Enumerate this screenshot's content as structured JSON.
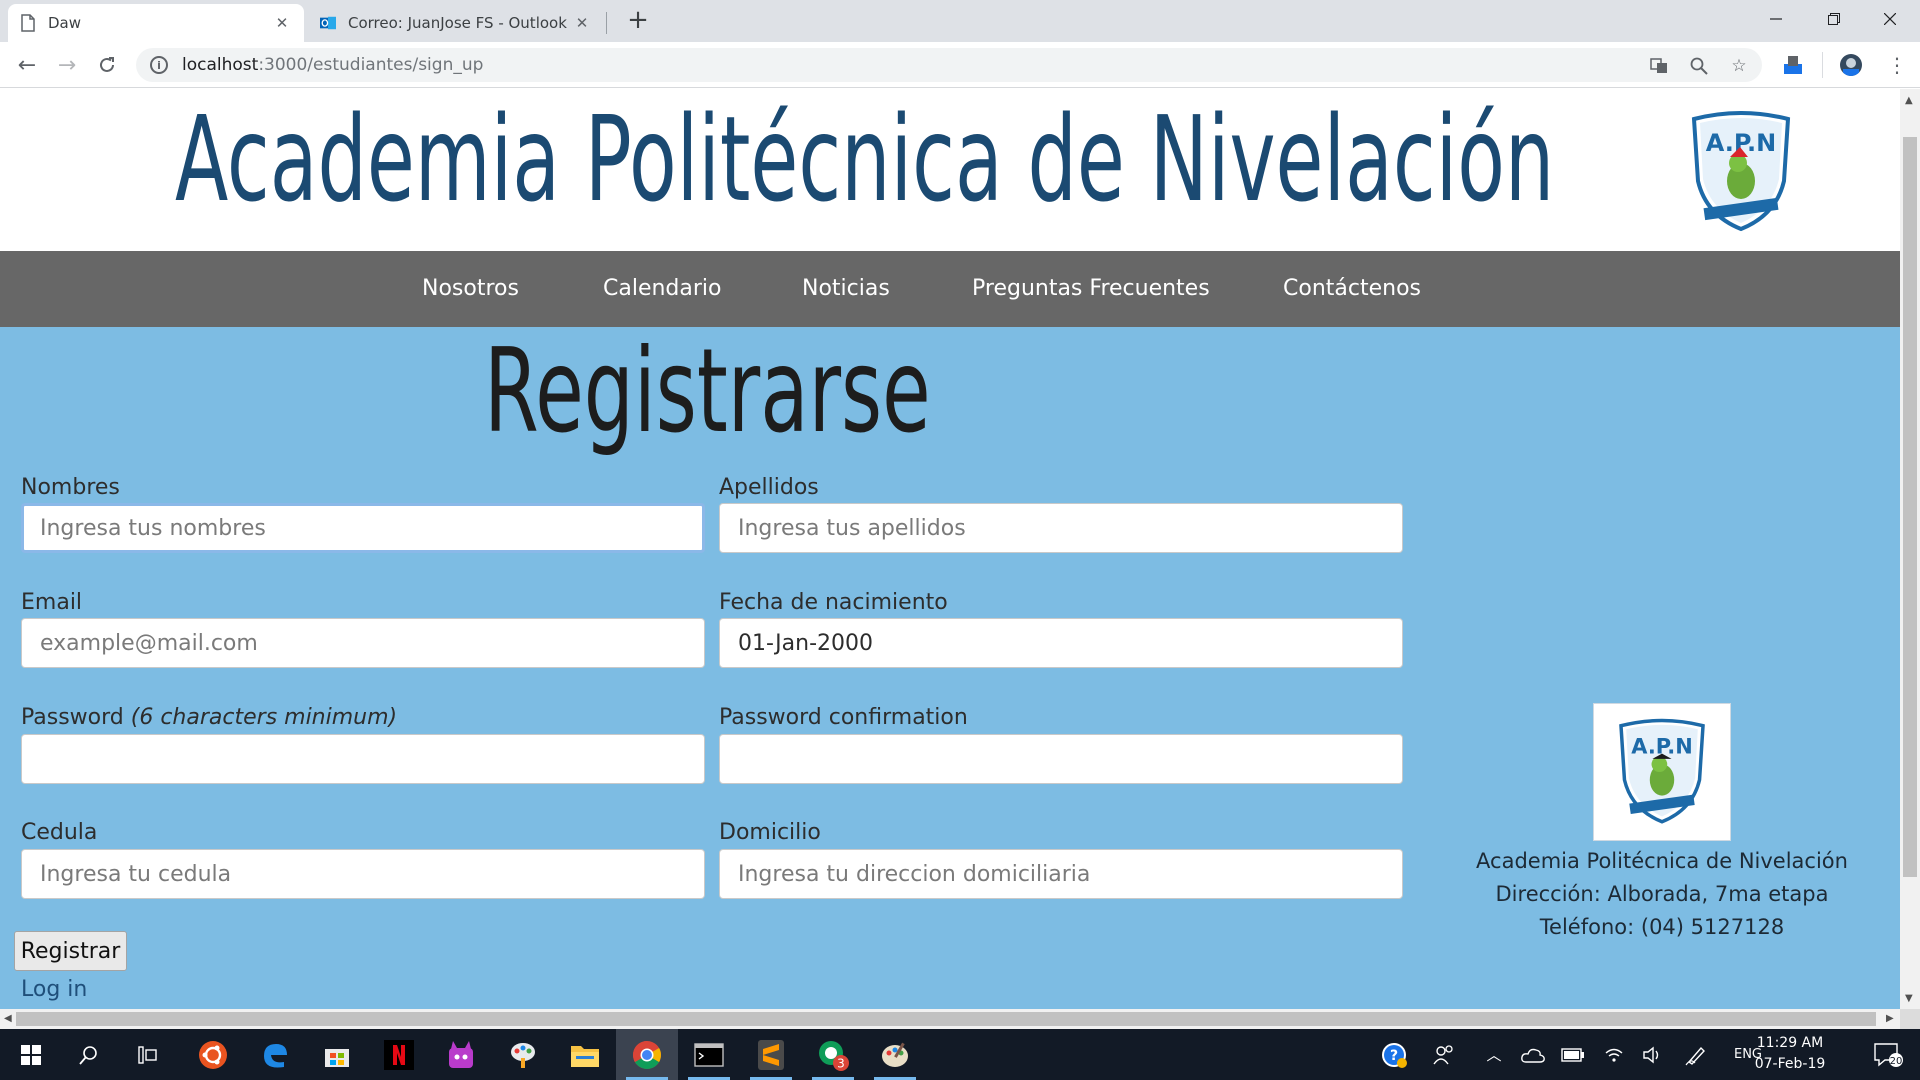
{
  "browser": {
    "tabs": [
      {
        "title": "Daw",
        "active": true
      },
      {
        "title": "Correo: JuanJose FS - Outlook",
        "active": false
      }
    ],
    "new_tab": "+",
    "url_host": "localhost",
    "url_path": ":3000/estudiantes/sign_up"
  },
  "site": {
    "title": "Academia Politécnica de Nivelación",
    "logo_text": "A.P.N",
    "nav": [
      "Nosotros",
      "Calendario",
      "Noticias",
      "Preguntas Frecuentes",
      "Contáctenos"
    ]
  },
  "form": {
    "heading": "Registrarse",
    "fields": {
      "nombres": {
        "label": "Nombres",
        "placeholder": "Ingresa tus nombres",
        "value": ""
      },
      "apellidos": {
        "label": "Apellidos",
        "placeholder": "Ingresa tus apellidos",
        "value": ""
      },
      "email": {
        "label": "Email",
        "placeholder": "example@mail.com",
        "value": ""
      },
      "fecha": {
        "label": "Fecha de nacimiento",
        "placeholder": "",
        "value": "01-Jan-2000"
      },
      "password": {
        "label": "Password",
        "hint": "(6 characters minimum)",
        "value": ""
      },
      "password_confirmation": {
        "label": "Password confirmation",
        "value": ""
      },
      "cedula": {
        "label": "Cedula",
        "placeholder": "Ingresa tu cedula",
        "value": ""
      },
      "domicilio": {
        "label": "Domicilio",
        "placeholder": "Ingresa tu direccion domiciliaria",
        "value": ""
      }
    },
    "submit_label": "Registrar",
    "login_link": "Log in"
  },
  "info": {
    "name": "Academia Politécnica de Nivelación",
    "address": "Dirección: Alborada, 7ma etapa",
    "phone": "Teléfono: (04) 5127128"
  },
  "taskbar": {
    "apps": [
      "start",
      "search",
      "task-view",
      "ubuntu",
      "edge",
      "store",
      "netflix",
      "game",
      "paint-3d",
      "file-explorer",
      "chrome",
      "terminal",
      "sublime-text",
      "hangouts",
      "paint"
    ],
    "active_app": "chrome",
    "hangouts_badge": "3",
    "language": "ENG",
    "time": "11:29 AM",
    "date": "07-Feb-19",
    "notifications": "20"
  },
  "colors": {
    "page_bg": "#7dbce3",
    "title": "#1b4a72",
    "nav_bg": "#676767",
    "taskbar_bg": "#121a26"
  }
}
